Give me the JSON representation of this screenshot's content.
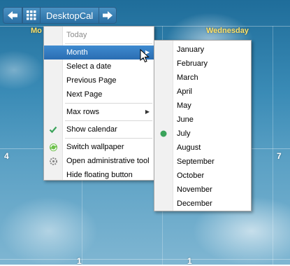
{
  "toolbar": {
    "title": "DesktopCal",
    "back_icon": "arrow-left-icon",
    "apps_icon": "grid-icon",
    "forward_icon": "arrow-right-icon"
  },
  "calendar": {
    "headers": {
      "monday": "Mo",
      "wednesday": "Wednesday"
    },
    "day_numbers": {
      "left_mid": "4",
      "right_mid": "7",
      "bottom_left": "1",
      "bottom_mid": "1"
    }
  },
  "context_menu": {
    "items": [
      {
        "label": "Today",
        "disabled": true
      },
      {
        "label": "Month",
        "submenu": true,
        "selected": true
      },
      {
        "label": "Select a date"
      },
      {
        "label": "Previous Page"
      },
      {
        "label": "Next Page"
      },
      {
        "label": "Max rows",
        "submenu": true
      },
      {
        "label": "Show calendar",
        "icon": "checkmark-icon"
      },
      {
        "label": "Switch wallpaper",
        "icon": "wallpaper-icon"
      },
      {
        "label": "Open administrative tool",
        "icon": "gear-icon"
      },
      {
        "label": "Hide floating button"
      }
    ]
  },
  "month_menu": {
    "months": [
      "January",
      "February",
      "March",
      "April",
      "May",
      "June",
      "July",
      "August",
      "September",
      "October",
      "November",
      "December"
    ],
    "current": "July"
  },
  "colors": {
    "accent": "#2a6db2",
    "header_text": "#ffe36a",
    "check": "#3aa35a"
  }
}
